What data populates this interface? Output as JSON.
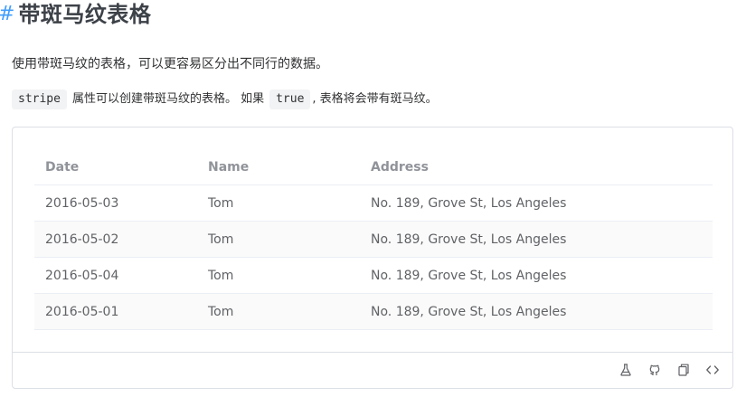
{
  "heading": {
    "anchor": "#",
    "title": "带斑马纹表格"
  },
  "description": "使用带斑马纹的表格，可以更容易区分出不同行的数据。",
  "attribute_note": {
    "code1": "stripe",
    "text1": "属性可以创建带斑马纹的表格。 如果",
    "code2": "true",
    "text2": ", 表格将会带有斑马纹。"
  },
  "table": {
    "columns": [
      "Date",
      "Name",
      "Address"
    ],
    "rows": [
      {
        "date": "2016-05-03",
        "name": "Tom",
        "address": "No. 189, Grove St, Los Angeles"
      },
      {
        "date": "2016-05-02",
        "name": "Tom",
        "address": "No. 189, Grove St, Los Angeles"
      },
      {
        "date": "2016-05-04",
        "name": "Tom",
        "address": "No. 189, Grove St, Los Angeles"
      },
      {
        "date": "2016-05-01",
        "name": "Tom",
        "address": "No. 189, Grove St, Los Angeles"
      }
    ]
  },
  "toolbar": {
    "icons": [
      "playground-flask-icon",
      "github-icon",
      "copy-icon",
      "view-source-icon"
    ]
  },
  "colors": {
    "accent": "#409eff",
    "stripe_row": "#fafafa",
    "border": "#dcdfe6"
  }
}
